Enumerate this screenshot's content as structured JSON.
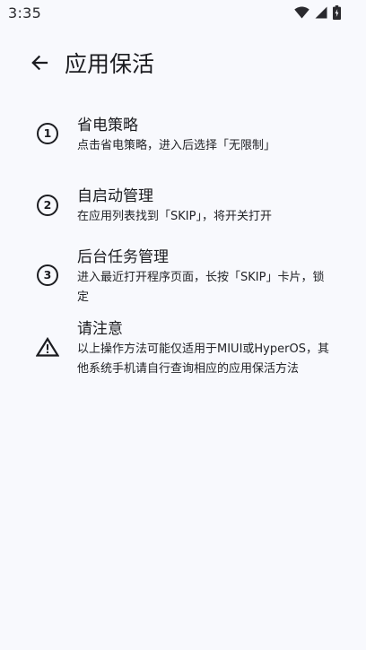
{
  "status_bar": {
    "time": "3:35",
    "icons": [
      "wifi-icon",
      "cellular-signal-icon",
      "battery-charging-icon"
    ]
  },
  "app_bar": {
    "back_icon": "arrow-back-icon",
    "title": "应用保活"
  },
  "items": [
    {
      "icon": "number-1",
      "icon_text": "1",
      "title": "省电策略",
      "description": "点击省电策略，进入后选择「无限制」"
    },
    {
      "icon": "number-2",
      "icon_text": "2",
      "title": "自启动管理",
      "description": "在应用列表找到「SKIP」，将开关打开"
    },
    {
      "icon": "number-3",
      "icon_text": "3",
      "title": "后台任务管理",
      "description": "进入最近打开程序页面，长按「SKIP」卡片，锁定"
    },
    {
      "icon": "warning-icon",
      "title": "请注意",
      "description": "以上操作方法可能仅适用于MIUI或HyperOS，其他系统手机请自行查询相应的应用保活方法"
    }
  ]
}
